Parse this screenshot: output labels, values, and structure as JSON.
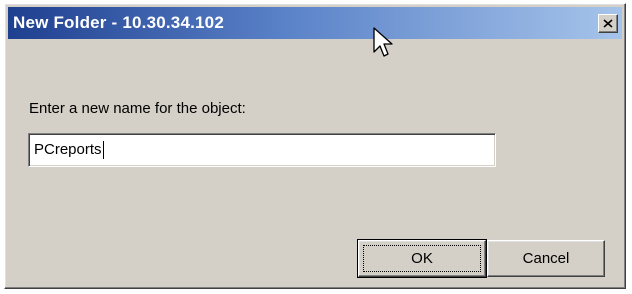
{
  "window": {
    "title": "New Folder - 10.30.34.102",
    "close_icon": "close-icon"
  },
  "dialog": {
    "prompt": "Enter a new name for the object:",
    "name_value": "PCreports",
    "ok_label": "OK",
    "cancel_label": "Cancel"
  },
  "colors": {
    "titlebar_start": "#1f3f8f",
    "titlebar_end": "#a6c4ea",
    "window_face": "#d4d0c8"
  }
}
